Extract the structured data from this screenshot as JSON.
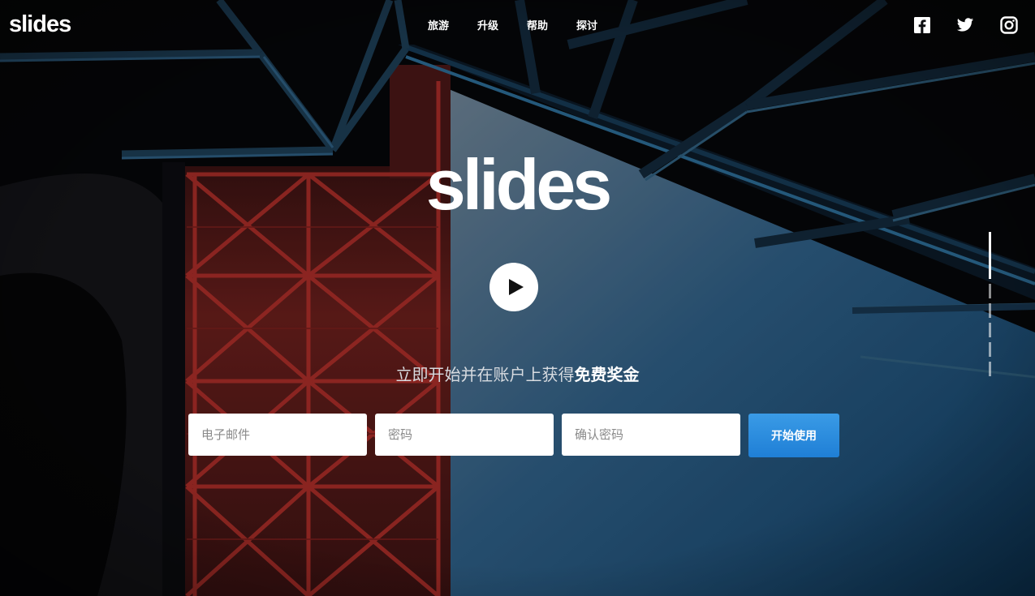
{
  "header": {
    "logo": "slides",
    "nav": [
      {
        "label": "旅游"
      },
      {
        "label": "升级"
      },
      {
        "label": "帮助"
      },
      {
        "label": "探讨"
      }
    ],
    "social_icons": [
      "facebook-icon",
      "twitter-icon",
      "instagram-icon"
    ]
  },
  "hero": {
    "logo": "slides",
    "play_icon": "play-icon",
    "tagline_prefix": "立即开始并在账户上获得",
    "tagline_bold": "免费奖金"
  },
  "signup": {
    "email_placeholder": "电子邮件",
    "password_placeholder": "密码",
    "confirm_placeholder": "确认密码",
    "submit_label": "开始使用"
  },
  "pager": {
    "slide_count": 5,
    "active_index": 0
  },
  "colors": {
    "accent": "#2a8ce0",
    "background": "#050608",
    "sky": "#2b6a96",
    "steel": "#b3302b"
  }
}
